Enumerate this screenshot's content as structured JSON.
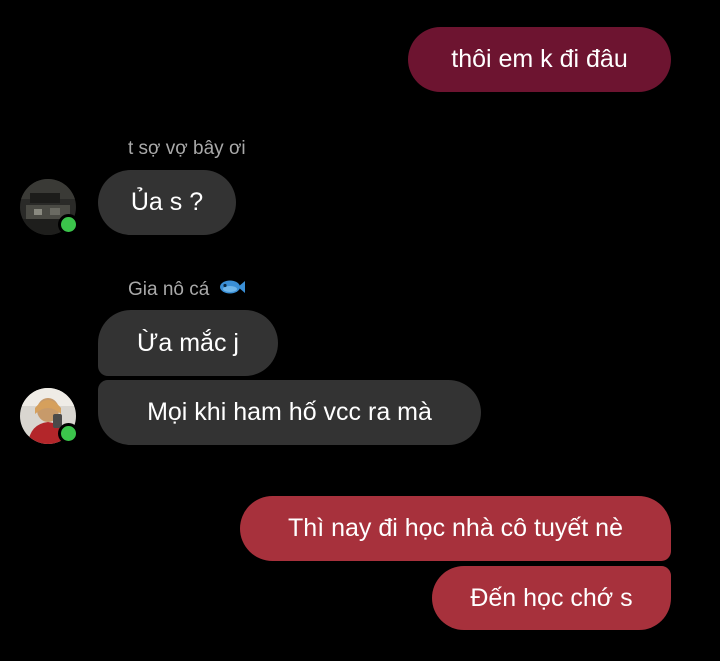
{
  "messages": [
    {
      "id": "m1",
      "direction": "outgoing",
      "text": "thôi em k đi đâu"
    },
    {
      "id": "m2",
      "direction": "incoming",
      "sender": "t sợ vợ bây ơi",
      "text": "Ủa s ?"
    },
    {
      "id": "m3",
      "direction": "incoming",
      "sender": "Gia nô cá",
      "text": "Ừa mắc j"
    },
    {
      "id": "m4",
      "direction": "incoming",
      "sender": "Gia nô cá",
      "text": "Mọi khi ham hố vcc ra mà"
    },
    {
      "id": "m5",
      "direction": "outgoing",
      "text": "Thì nay đi học nhà cô tuyết nè"
    },
    {
      "id": "m6",
      "direction": "outgoing",
      "text": "Đến học chớ s"
    }
  ],
  "senders": {
    "sender1": {
      "name": "t sợ vợ bây ơi",
      "online": true
    },
    "sender2": {
      "name": "Gia nô cá",
      "emoji_icon": "fish-icon",
      "online": true
    }
  },
  "colors": {
    "background": "#000000",
    "outgoing_dark": "#6d1430",
    "outgoing": "#a7313c",
    "incoming": "#333333",
    "online": "#3bc44b",
    "sender_name": "#a9a9a9"
  }
}
